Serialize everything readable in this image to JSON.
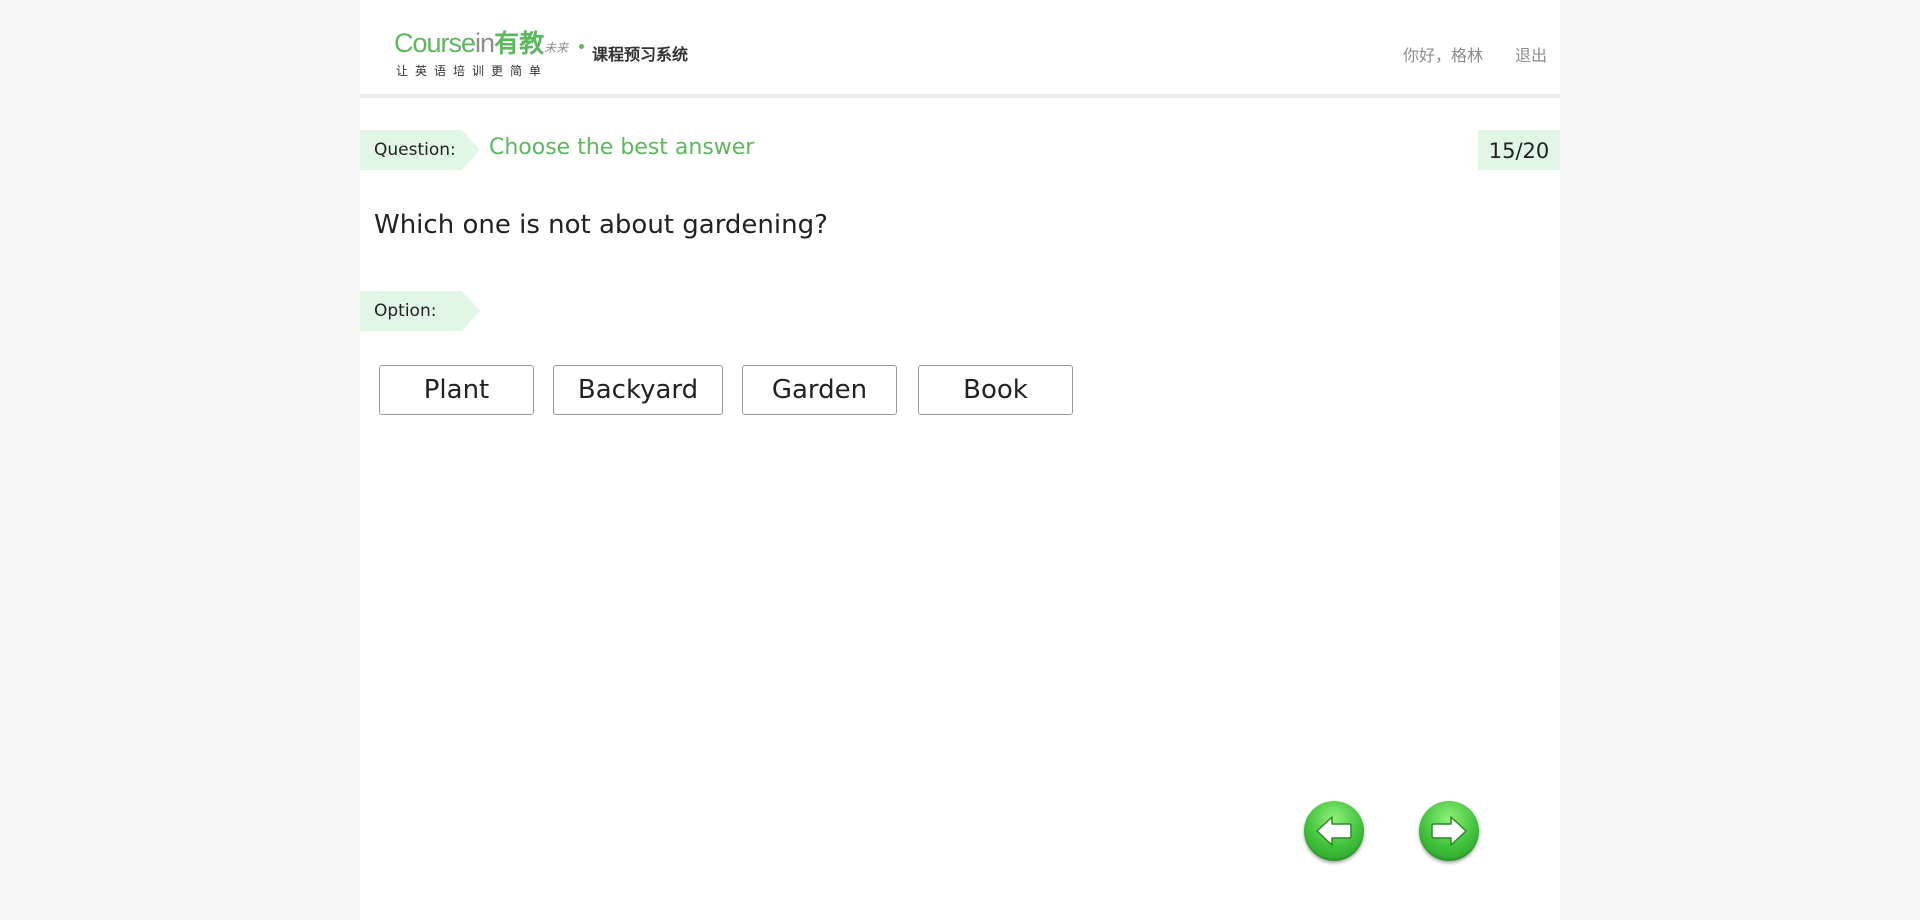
{
  "brand": {
    "course": "Course",
    "in": "in",
    "cn_name": "有教",
    "cn_small": "未来",
    "system_name": "课程预习系统",
    "slogan": "让英语培训更简单"
  },
  "user": {
    "greeting": "你好，格林",
    "logout_label": "退出"
  },
  "question": {
    "tag_label": "Question:",
    "instruction": "Choose the best answer",
    "progress": "15/20",
    "current": 15,
    "total": 20,
    "text": "Which one is not about gardening?"
  },
  "options": {
    "tag_label": "Option:",
    "items": [
      {
        "label": "Plant"
      },
      {
        "label": "Backyard"
      },
      {
        "label": "Garden"
      },
      {
        "label": "Book"
      }
    ]
  },
  "navigation": {
    "prev_icon": "arrow-left-icon",
    "next_icon": "arrow-right-icon"
  },
  "colors": {
    "accent": "#5bb85c",
    "tag_background": "#e2f6e6",
    "page_background": "#f6f6f6"
  }
}
